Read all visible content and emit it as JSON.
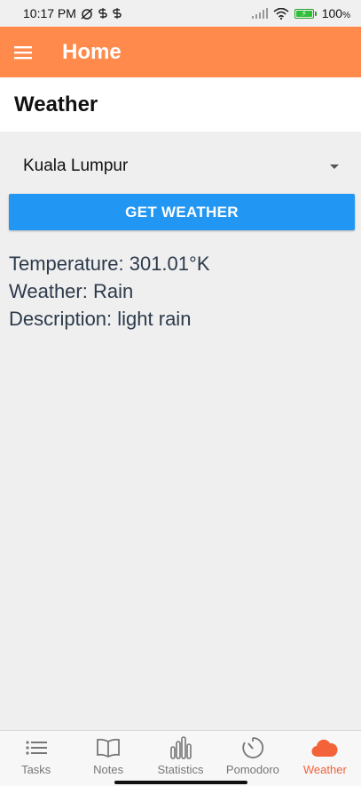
{
  "status_bar": {
    "time": "10:17 PM",
    "battery_percent": "100"
  },
  "app_bar": {
    "menu_icon": "hamburger-menu-icon",
    "title": "Home"
  },
  "screen": {
    "title": "Weather"
  },
  "picker": {
    "selected": "Kuala Lumpur"
  },
  "button": {
    "label": "GET WEATHER",
    "color": "#2196f3"
  },
  "weather": {
    "temperature": "Temperature: 301.01°K",
    "condition": "Weather: Rain",
    "description": "Description: light rain"
  },
  "tabs": [
    {
      "label": "Tasks",
      "icon": "list-icon"
    },
    {
      "label": "Notes",
      "icon": "book-icon"
    },
    {
      "label": "Statistics",
      "icon": "bar-chart-icon"
    },
    {
      "label": "Pomodoro",
      "icon": "timer-icon"
    },
    {
      "label": "Weather",
      "icon": "cloud-icon",
      "active": true
    }
  ],
  "colors": {
    "app_bar": "#ff8a4c",
    "active_tab": "#f4623a"
  }
}
